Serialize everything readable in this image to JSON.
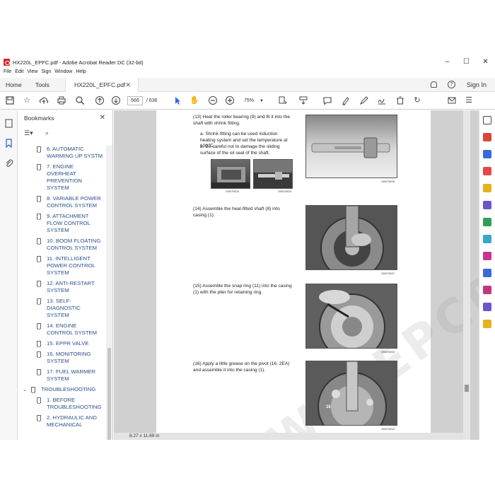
{
  "window": {
    "title": "HX220L_EPFC.pdf - Adobe Acrobat Reader DC (32-bit)"
  },
  "menu": [
    "File",
    "Edit",
    "View",
    "Sign",
    "Window",
    "Help"
  ],
  "tabs": {
    "home": "Home",
    "tools": "Tools",
    "document": "HX220L_EPFC.pdf"
  },
  "account": {
    "signin": "Sign In"
  },
  "toolbar": {
    "page_current": "566",
    "page_total": "/ 636",
    "zoom": "75%"
  },
  "bookmarks": {
    "title": "Bookmarks",
    "items": [
      {
        "label": "6. AUTOMATIC WARMING UP SYSTM",
        "level": 2
      },
      {
        "label": "7. ENGINE OVERHEAT PREVENTION SYSTEM",
        "level": 2
      },
      {
        "label": "8. VARIABLE POWER CONTROL SYSTEM",
        "level": 2
      },
      {
        "label": "9. ATTACHMENT FLOW CONTROL SYSTEM",
        "level": 2
      },
      {
        "label": "10. BOOM FLOATING CONTROL SYSTEM",
        "level": 2
      },
      {
        "label": "11. INTELLIGENT POWER CONTROL SYSTEM",
        "level": 2
      },
      {
        "label": "12. ANTI-RESTART SYSTEM",
        "level": 2
      },
      {
        "label": "13. SELF-DIAGNOSTIC SYSTEM",
        "level": 2
      },
      {
        "label": "14. ENGINE CONTROL SYSTEM",
        "level": 2
      },
      {
        "label": "15. EPPR VALVE",
        "level": 2
      },
      {
        "label": "16. MONITORING SYSTEM",
        "level": 2
      },
      {
        "label": "17. FUEL WARMER SYSTEM",
        "level": 2
      },
      {
        "label": "TROUBLESHOOTING",
        "level": 1
      },
      {
        "label": "1. BEFORE TROUBLESHOOTING",
        "level": 2
      },
      {
        "label": "2. HYDRAULIC AND MECHANICAL",
        "level": 2
      }
    ]
  },
  "status": {
    "page_size": "8.27 x 11.69 in"
  },
  "page": {
    "watermark": "WWW.EPCDEPO.COM",
    "step13": {
      "title": "(13) Heat the roller bearing (9) and fit it into the shaft with shrink fitting.",
      "a": "a. Shrink fitting can be used induction heating system and set the temperature at 100℃.",
      "b": "b. Be careful not to damage the sliding surface of the oil seal of the shaft.",
      "photo_id": "2508TM036",
      "sub1": "2508TM034",
      "sub2": "2508TM035"
    },
    "step14": {
      "title": "(14) Assemble the heat-fitted shaft (8) into casing (1).",
      "photo_id": "2508TM037"
    },
    "step15": {
      "title": "(15) Assemble the snap ring (11) into the casing (1) with the plier for retaining ring.",
      "photo_id": "2508TM038"
    },
    "step16": {
      "title": "(16) Apply a little grease on the pivot (16, 2EA) and assemble it into the casing (1).",
      "photo_id": "2508TM039",
      "label": "16"
    }
  }
}
